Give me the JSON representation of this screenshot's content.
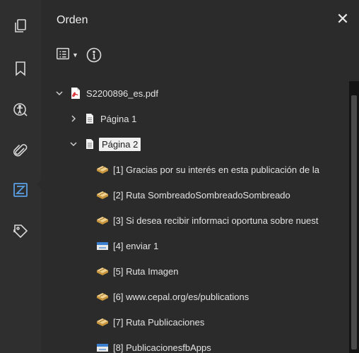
{
  "sidebar": {
    "buttons": [
      {
        "name": "pages-icon"
      },
      {
        "name": "bookmark-icon"
      },
      {
        "name": "accessibility-icon"
      },
      {
        "name": "attachment-icon"
      },
      {
        "name": "tags-icon",
        "active": true
      },
      {
        "name": "content-icon"
      }
    ]
  },
  "panel": {
    "title": "Orden",
    "close_label": "✕"
  },
  "tree": {
    "root": {
      "label": "S2200896_es.pdf"
    },
    "pages": [
      {
        "label": "Página 1",
        "expanded": false
      },
      {
        "label": "Página 2",
        "expanded": true,
        "selected": true
      }
    ],
    "items": [
      {
        "label": "[1]  Gracias por su interés en esta publicación de la",
        "icon": "tag-icon"
      },
      {
        "label": "[2]  Ruta SombreadoSombreadoSombreado",
        "icon": "tag-icon"
      },
      {
        "label": "[3]  Si desea recibir informaci oportuna sobre nuest",
        "icon": "tag-icon"
      },
      {
        "label": "[4]  enviar 1",
        "icon": "figure-icon"
      },
      {
        "label": "[5]  Ruta Imagen",
        "icon": "tag-icon"
      },
      {
        "label": "[6]  www.cepal.org/es/publications",
        "icon": "tag-icon"
      },
      {
        "label": "[7]  Ruta Publicaciones",
        "icon": "tag-icon"
      },
      {
        "label": "[8]  PublicacionesfbApps",
        "icon": "figure-icon"
      }
    ]
  },
  "colors": {
    "background": "#2b2b2b",
    "accent": "#5aa0e6",
    "pdf_red": "#d8262b",
    "selection_bg": "#f0f0f0"
  }
}
